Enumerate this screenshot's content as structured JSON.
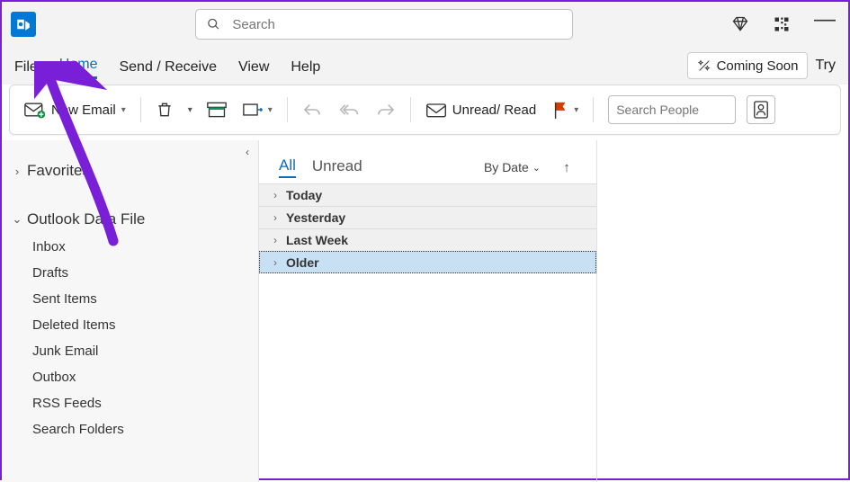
{
  "titlebar": {
    "search_placeholder": "Search"
  },
  "menubar": {
    "items": [
      "File",
      "Home",
      "Send / Receive",
      "View",
      "Help"
    ],
    "active_index": 1,
    "coming_soon": "Coming Soon",
    "try": "Try"
  },
  "ribbon": {
    "new_email": "New Email",
    "unread_read": "Unread/ Read",
    "search_people_placeholder": "Search People"
  },
  "sidebar": {
    "favorites": "Favorites",
    "datafile": "Outlook Data File",
    "folders": [
      "Inbox",
      "Drafts",
      "Sent Items",
      "Deleted Items",
      "Junk Email",
      "Outbox",
      "RSS Feeds",
      "Search Folders"
    ]
  },
  "list": {
    "tabs": {
      "all": "All",
      "unread": "Unread"
    },
    "by_date": "By Date",
    "groups": [
      "Today",
      "Yesterday",
      "Last Week",
      "Older"
    ],
    "selected_group": 3
  }
}
